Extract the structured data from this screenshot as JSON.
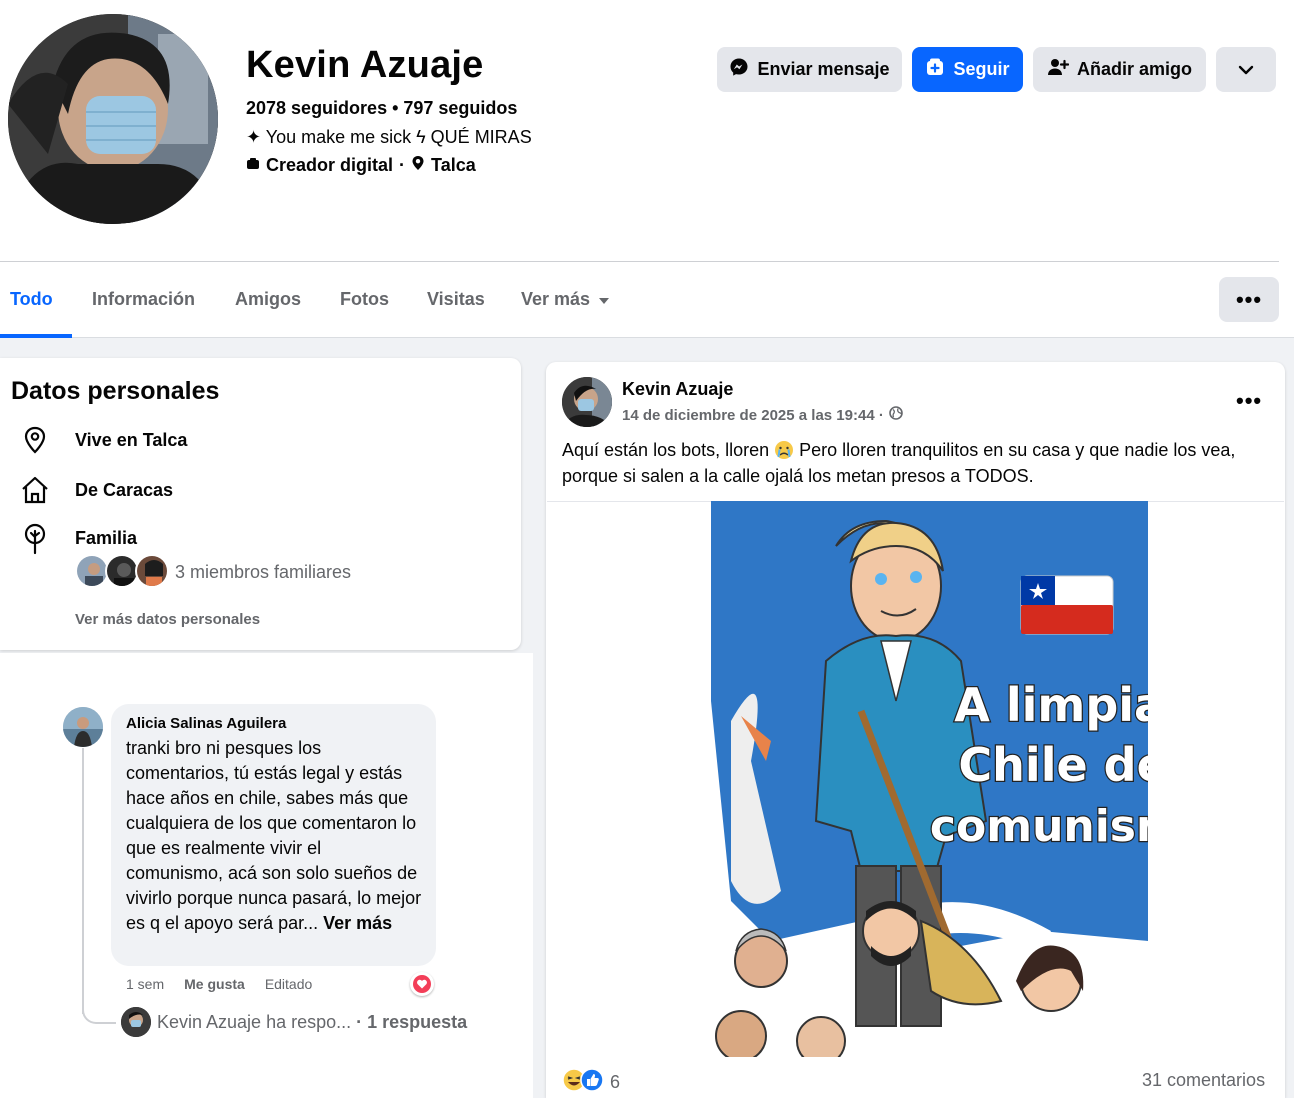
{
  "profile": {
    "name": "Kevin Azuaje",
    "stats": "2078 seguidores • 797 seguidos",
    "bio": "✦ You make me sick ϟ QUÉ MIRAS",
    "category": "Creador digital",
    "meta_sep": "·",
    "location": "Talca"
  },
  "actions": {
    "message": "Enviar mensaje",
    "follow": "Seguir",
    "add_friend": "Añadir amigo"
  },
  "tabs": {
    "all": "Todo",
    "info": "Información",
    "friends": "Amigos",
    "photos": "Fotos",
    "checkins": "Visitas",
    "more": "Ver más"
  },
  "personal": {
    "title": "Datos personales",
    "lives": "Vive en Talca",
    "from": "De Caracas",
    "family": "Familia",
    "family_count": "3 miembros familiares",
    "see_more": "Ver más datos personales"
  },
  "comment": {
    "author": "Alicia Salinas Aguilera",
    "text": "tranki bro ni pesques los comentarios, tú estás legal y estás hace años en chile, sabes más que cualquiera de los que comentaron lo que es realmente vivir el comunismo, acá son solo sueños de vivirlo porque nunca pasará, lo mejor es q el apoyo será par...",
    "see_more": "Ver más",
    "time": "1 sem",
    "like": "Me gusta",
    "edited": "Editado",
    "reply_summary": "Kevin Azuaje ha respo...",
    "reply_count": "· 1 respuesta"
  },
  "post": {
    "author": "Kevin Azuaje",
    "date": "14 de diciembre de 2025 a las 19:44 ·",
    "text_a": "Aquí están los bots, lloren",
    "text_b": " Pero lloren tranquilitos en su casa y que nadie los vea, porque si salen a la calle ojalá los metan presos a TODOS.",
    "image_line1": "A limpiar",
    "image_line2": "Chile del",
    "image_line3": "comunismo",
    "reactions": "6",
    "comments": "31 comentarios"
  },
  "colors": {
    "accent": "#0866ff",
    "button_gray": "#e4e6eb",
    "secondary_text": "#65676b",
    "feed_bg": "#f0f2f5",
    "image_blue": "#2f77c6"
  }
}
